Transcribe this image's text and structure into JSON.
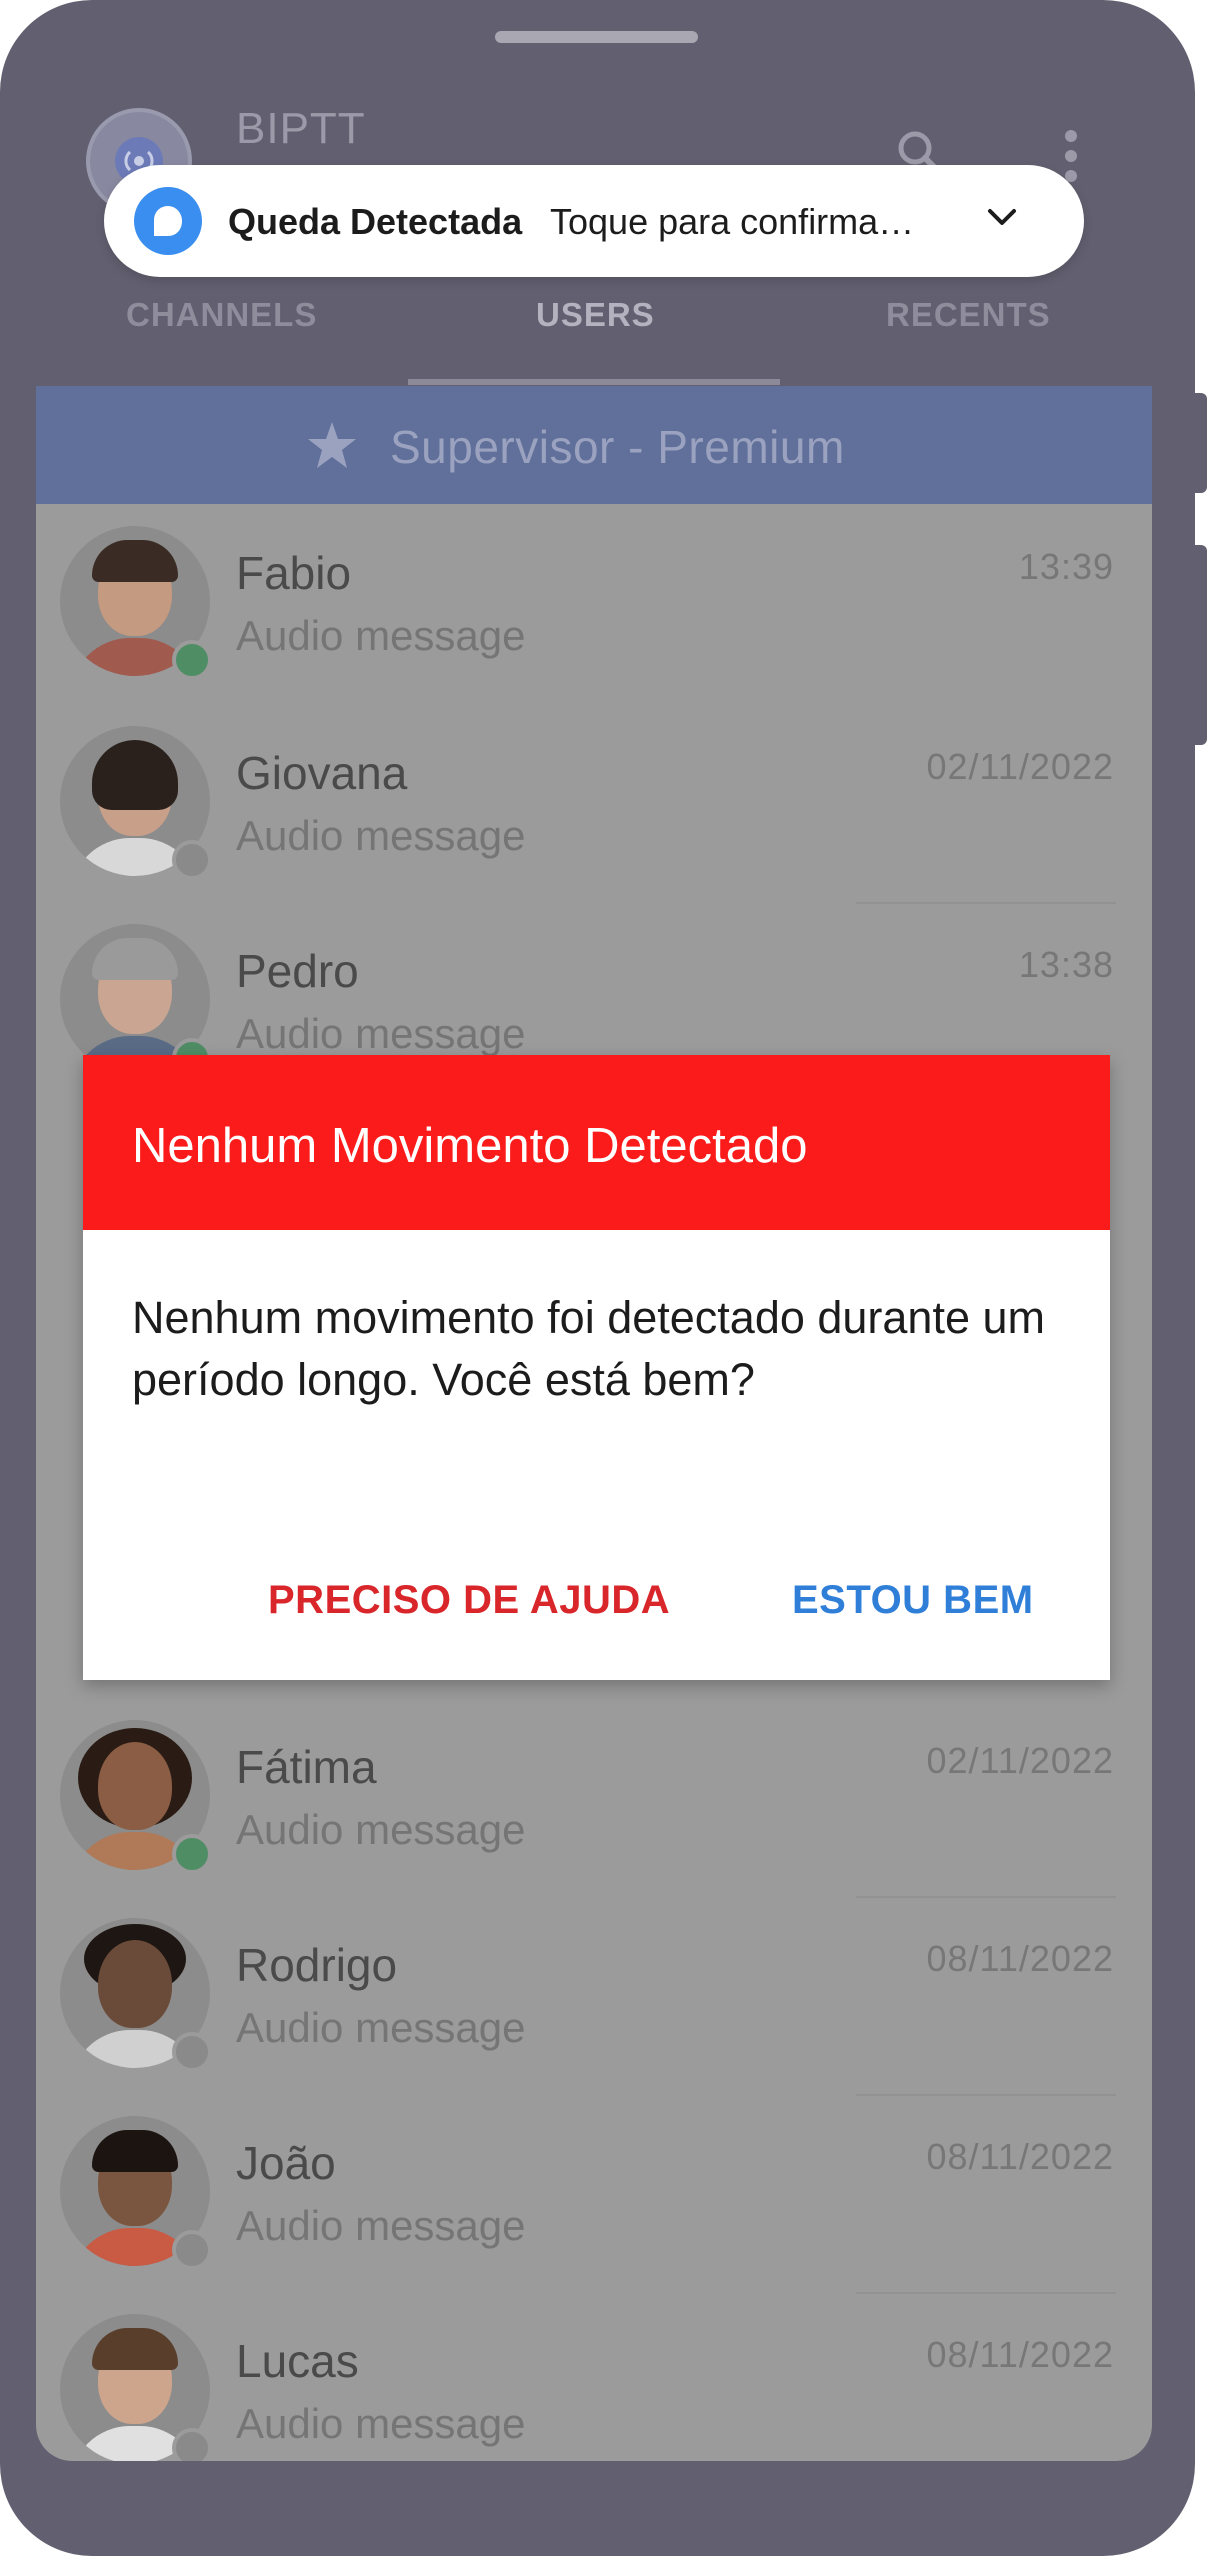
{
  "app": {
    "title": "BIPTT"
  },
  "notification": {
    "title": "Queda Detectada",
    "text": "Toque para confirma…"
  },
  "tabs": [
    {
      "label": "CHANNELS"
    },
    {
      "label": "USERS"
    },
    {
      "label": "RECENTS"
    }
  ],
  "supervisor_bar": {
    "label": "Supervisor  -  Premium"
  },
  "users": [
    {
      "name": "Fabio",
      "subtitle": "Audio message",
      "time": "13:39",
      "status": "online"
    },
    {
      "name": "Giovana",
      "subtitle": "Audio message",
      "time": "02/11/2022",
      "status": "offline"
    },
    {
      "name": "Pedro",
      "subtitle": "Audio message",
      "time": "13:38",
      "status": "online"
    },
    {
      "name": "Fátima",
      "subtitle": "Audio message",
      "time": "02/11/2022",
      "status": "online"
    },
    {
      "name": "Rodrigo",
      "subtitle": "Audio message",
      "time": "08/11/2022",
      "status": "offline"
    },
    {
      "name": "João",
      "subtitle": "Audio message",
      "time": "08/11/2022",
      "status": "offline"
    },
    {
      "name": "Lucas",
      "subtitle": "Audio message",
      "time": "08/11/2022",
      "status": "offline"
    }
  ],
  "dialog": {
    "title": "Nenhum Movimento Detectado",
    "message": "Nenhum movimento foi detectado durante um período longo. Você está bem?",
    "help_button": "PRECISO DE AJUDA",
    "ok_button": "ESTOU BEM"
  },
  "colors": {
    "dialog_header": "#fb1b1b",
    "help_button": "#d9262b",
    "ok_button": "#2f7fd9",
    "online": "#4f8d65",
    "supervisor_bar": "#60709a"
  }
}
